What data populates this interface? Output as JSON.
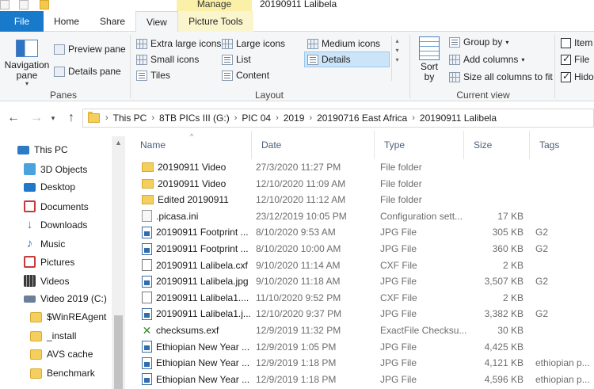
{
  "window": {
    "title": "20190911 Lalibela",
    "context_tab_group": "Manage"
  },
  "tabs": [
    {
      "label": "File"
    },
    {
      "label": "Home"
    },
    {
      "label": "Share"
    },
    {
      "label": "View"
    },
    {
      "label": "Picture Tools"
    }
  ],
  "ribbon": {
    "panes": {
      "navigation_pane": "Navigation pane",
      "preview_pane": "Preview pane",
      "details_pane": "Details pane",
      "label": "Panes"
    },
    "layout": {
      "extra_large_icons": "Extra large icons",
      "large_icons": "Large icons",
      "medium_icons": "Medium icons",
      "small_icons": "Small icons",
      "list": "List",
      "details": "Details",
      "tiles": "Tiles",
      "content": "Content",
      "label": "Layout"
    },
    "current_view": {
      "sort_by": "Sort by",
      "group_by": "Group by",
      "add_columns": "Add columns",
      "size_all_columns": "Size all columns to fit",
      "label": "Current view"
    },
    "show_hide": {
      "item": "Item",
      "file": "File",
      "hidden": "Hido"
    }
  },
  "breadcrumb": [
    "This PC",
    "8TB PICs III (G:)",
    "PIC 04",
    "2019",
    "20190716 East Africa",
    "20190911 Lalibela"
  ],
  "nav_items": [
    {
      "label": "This PC",
      "icon": "pc-icon",
      "color": "#2d7bc7"
    },
    {
      "label": "3D Objects",
      "icon": "cube-icon",
      "color": "#4aa3df"
    },
    {
      "label": "Desktop",
      "icon": "desktop-icon",
      "color": "#1f78c8"
    },
    {
      "label": "Documents",
      "icon": "documents-icon",
      "color": "#c43b3b"
    },
    {
      "label": "Downloads",
      "icon": "download-icon",
      "color": "#2e79c9"
    },
    {
      "label": "Music",
      "icon": "music-icon",
      "color": "#2a6fbb"
    },
    {
      "label": "Pictures",
      "icon": "pictures-icon",
      "color": "#c43b3b"
    },
    {
      "label": "Videos",
      "icon": "videos-icon",
      "color": "#3a3a3a"
    },
    {
      "label": "Video 2019 (C:)",
      "icon": "drive-icon",
      "color": "#6b7f99"
    },
    {
      "label": "$WinREAgent",
      "icon": "folder-icon",
      "color": "#f5cf5d"
    },
    {
      "label": "_install",
      "icon": "folder-icon",
      "color": "#f5cf5d"
    },
    {
      "label": "AVS cache",
      "icon": "folder-icon",
      "color": "#f5cf5d"
    },
    {
      "label": "Benchmark",
      "icon": "folder-icon",
      "color": "#f5cf5d"
    }
  ],
  "columns": {
    "name": "Name",
    "date": "Date",
    "type": "Type",
    "size": "Size",
    "tags": "Tags"
  },
  "files": [
    {
      "name": "20190911 Video",
      "date": "27/3/2020 11:27 PM",
      "type": "File folder",
      "size": "",
      "tags": "",
      "icon": "folder"
    },
    {
      "name": "20190911 Video",
      "date": "12/10/2020 11:09 AM",
      "type": "File folder",
      "size": "",
      "tags": "",
      "icon": "folder"
    },
    {
      "name": "Edited 20190911",
      "date": "12/10/2020 11:12 AM",
      "type": "File folder",
      "size": "",
      "tags": "",
      "icon": "folder"
    },
    {
      "name": ".picasa.ini",
      "date": "23/12/2019 10:05 PM",
      "type": "Configuration sett...",
      "size": "17 KB",
      "tags": "",
      "icon": "ini"
    },
    {
      "name": "20190911 Footprint ...",
      "date": "8/10/2020 9:53 AM",
      "type": "JPG File",
      "size": "305 KB",
      "tags": "G2",
      "icon": "jpg"
    },
    {
      "name": "20190911 Footprint ...",
      "date": "8/10/2020 10:00 AM",
      "type": "JPG File",
      "size": "360 KB",
      "tags": "G2",
      "icon": "jpg"
    },
    {
      "name": "20190911 Lalibela.cxf",
      "date": "9/10/2020 11:14 AM",
      "type": "CXF File",
      "size": "2 KB",
      "tags": "",
      "icon": "doc"
    },
    {
      "name": "20190911 Lalibela.jpg",
      "date": "9/10/2020 11:18 AM",
      "type": "JPG File",
      "size": "3,507 KB",
      "tags": "G2",
      "icon": "jpg"
    },
    {
      "name": "20190911 Lalibela1....",
      "date": "11/10/2020 9:52 PM",
      "type": "CXF File",
      "size": "2 KB",
      "tags": "",
      "icon": "doc"
    },
    {
      "name": "20190911 Lalibela1.j...",
      "date": "12/10/2020 9:37 PM",
      "type": "JPG File",
      "size": "3,382 KB",
      "tags": "G2",
      "icon": "jpg"
    },
    {
      "name": "checksums.exf",
      "date": "12/9/2019 11:32 PM",
      "type": "ExactFile Checksu...",
      "size": "30 KB",
      "tags": "",
      "icon": "exf"
    },
    {
      "name": "Ethiopian New Year ...",
      "date": "12/9/2019 1:05 PM",
      "type": "JPG File",
      "size": "4,425 KB",
      "tags": "",
      "icon": "jpg"
    },
    {
      "name": "Ethiopian New Year ...",
      "date": "12/9/2019 1:18 PM",
      "type": "JPG File",
      "size": "4,121 KB",
      "tags": "ethiopian p...",
      "icon": "jpg"
    },
    {
      "name": "Ethiopian New Year ...",
      "date": "12/9/2019 1:18 PM",
      "type": "JPG File",
      "size": "4,596 KB",
      "tags": "ethiopian p...",
      "icon": "jpg"
    }
  ]
}
